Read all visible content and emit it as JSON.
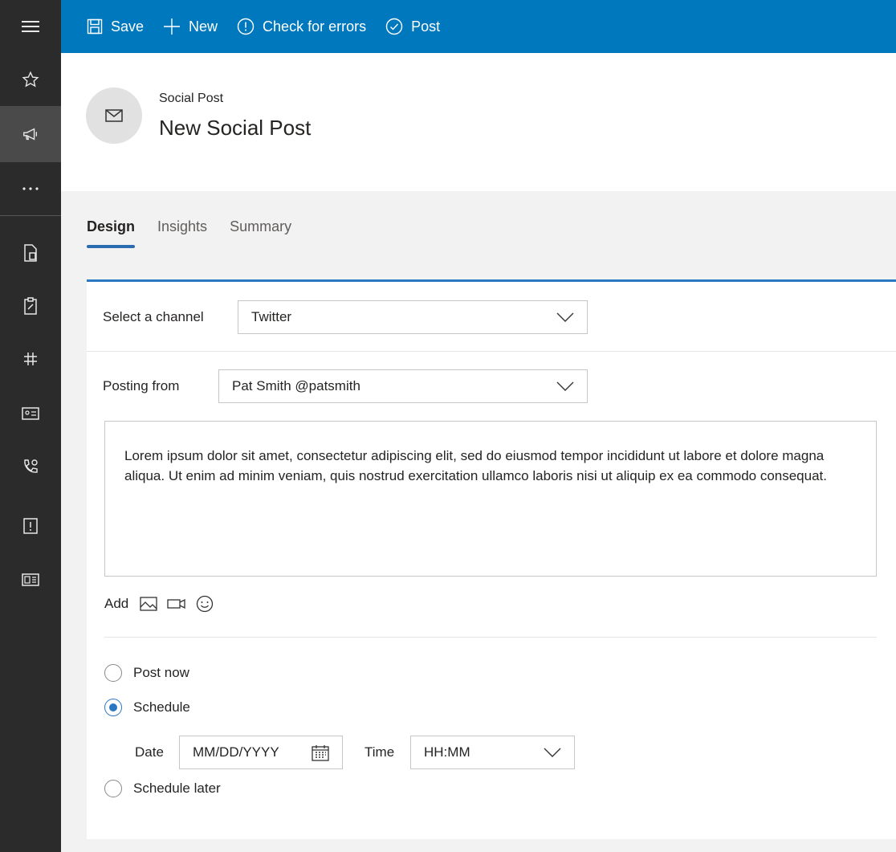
{
  "command_bar": {
    "save": "Save",
    "new": "New",
    "check_errors": "Check for errors",
    "post": "Post"
  },
  "rail": {
    "items": [
      "menu-icon",
      "star-icon",
      "megaphone-icon",
      "more-icon",
      "document-icon",
      "clipboard-icon",
      "grid-icon",
      "contact-card-icon",
      "phone-settings-icon",
      "alert-box-icon",
      "news-icon"
    ],
    "active": "megaphone-icon"
  },
  "header": {
    "entity_type": "Social Post",
    "entity_name": "New Social Post"
  },
  "tabs": [
    {
      "label": "Design",
      "active": true
    },
    {
      "label": "Insights",
      "active": false
    },
    {
      "label": "Summary",
      "active": false
    }
  ],
  "form": {
    "channel_label": "Select a channel",
    "channel_value": "Twitter",
    "posting_from_label": "Posting from",
    "posting_from_value": "Pat Smith @patsmith",
    "message": "Lorem ipsum dolor sit amet, consectetur adipiscing elit, sed do eiusmod tempor incididunt ut labore et dolore magna aliqua. Ut enim ad minim veniam, quis nostrud exercitation ullamco laboris nisi ut aliquip ex ea commodo consequat.",
    "add_label": "Add",
    "post_now": "Post now",
    "schedule": "Schedule",
    "schedule_later": "Schedule later",
    "selected_option": "Schedule",
    "date_label": "Date",
    "date_placeholder": "MM/DD/YYYY",
    "time_label": "Time",
    "time_placeholder": "HH:MM"
  },
  "colors": {
    "command_bar": "#0078be",
    "rail": "#2b2b2b",
    "accent": "#2b78c2"
  }
}
